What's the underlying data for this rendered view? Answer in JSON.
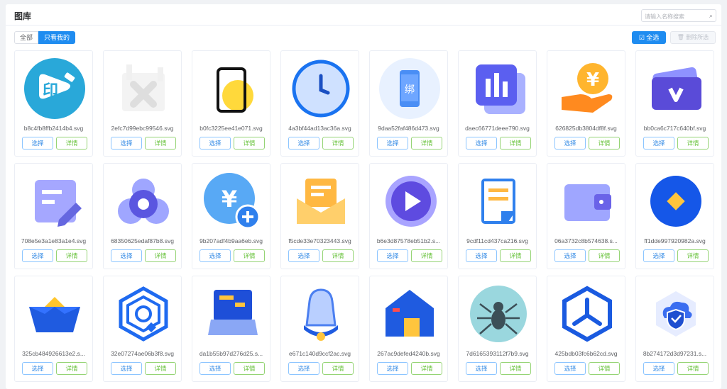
{
  "page": {
    "title": "图库"
  },
  "search": {
    "placeholder": "请输入名称搜索",
    "icon": "search-icon"
  },
  "filter": {
    "all_label": "全部",
    "mine_label": "只看我的",
    "active": "mine"
  },
  "toolbar": {
    "select_all_label": "全选",
    "delete_selected_label": "删除所选"
  },
  "card_buttons": {
    "select_label": "选择",
    "detail_label": "详情"
  },
  "colors": {
    "primary": "#1f8cf0",
    "success": "#67c23a"
  },
  "items": [
    {
      "name": "b8c4fb8ffb2414b4.svg",
      "icon": "print-app-icon"
    },
    {
      "name": "2efc7d99ebc99546.svg",
      "icon": "broken-image-icon"
    },
    {
      "name": "b0fc3225ee41e071.svg",
      "icon": "phone-circle-icon"
    },
    {
      "name": "4a3bf44ad13ac36a.svg",
      "icon": "clock-icon"
    },
    {
      "name": "9daa52faf486d473.svg",
      "icon": "phone-bind-icon"
    },
    {
      "name": "daec66771deee790.svg",
      "icon": "bar-chart-icon"
    },
    {
      "name": "626825db3804df8f.svg",
      "icon": "yen-hand-icon"
    },
    {
      "name": "bb0ca6c717c640bf.svg",
      "icon": "v-card-icon"
    },
    {
      "name": "708e5e3a1e83a1e4.svg",
      "icon": "note-edit-icon"
    },
    {
      "name": "68350625edaf87b8.svg",
      "icon": "circles-icon"
    },
    {
      "name": "9b207adf4b9aa6eb.svg",
      "icon": "yen-plus-icon"
    },
    {
      "name": "f5cde33e70323443.svg",
      "icon": "mail-open-icon"
    },
    {
      "name": "b6e3d87578eb51b2.s...",
      "icon": "play-icon"
    },
    {
      "name": "9cdf11cd437ca216.svg",
      "icon": "document-icon"
    },
    {
      "name": "06a3732c8b574638.s...",
      "icon": "wallet-icon"
    },
    {
      "name": "ff1dde997920982a.svg",
      "icon": "diamond-circle-icon"
    },
    {
      "name": "325cb484926613e2.s...",
      "icon": "gold-ingot-icon"
    },
    {
      "name": "32e07274ae06b3f8.svg",
      "icon": "hexagon-rings-icon"
    },
    {
      "name": "da1b55b97d276d25.s...",
      "icon": "card-terminal-icon"
    },
    {
      "name": "e671c140d9ccf2ac.svg",
      "icon": "bell-icon"
    },
    {
      "name": "267ac9defed4240b.svg",
      "icon": "house-icon"
    },
    {
      "name": "7d6165393112f7b9.svg",
      "icon": "spider-icon"
    },
    {
      "name": "425bdb03fc6b62cd.svg",
      "icon": "fan-hexagon-icon"
    },
    {
      "name": "8b274172d3d97231.s...",
      "icon": "cloud-shield-icon"
    }
  ]
}
